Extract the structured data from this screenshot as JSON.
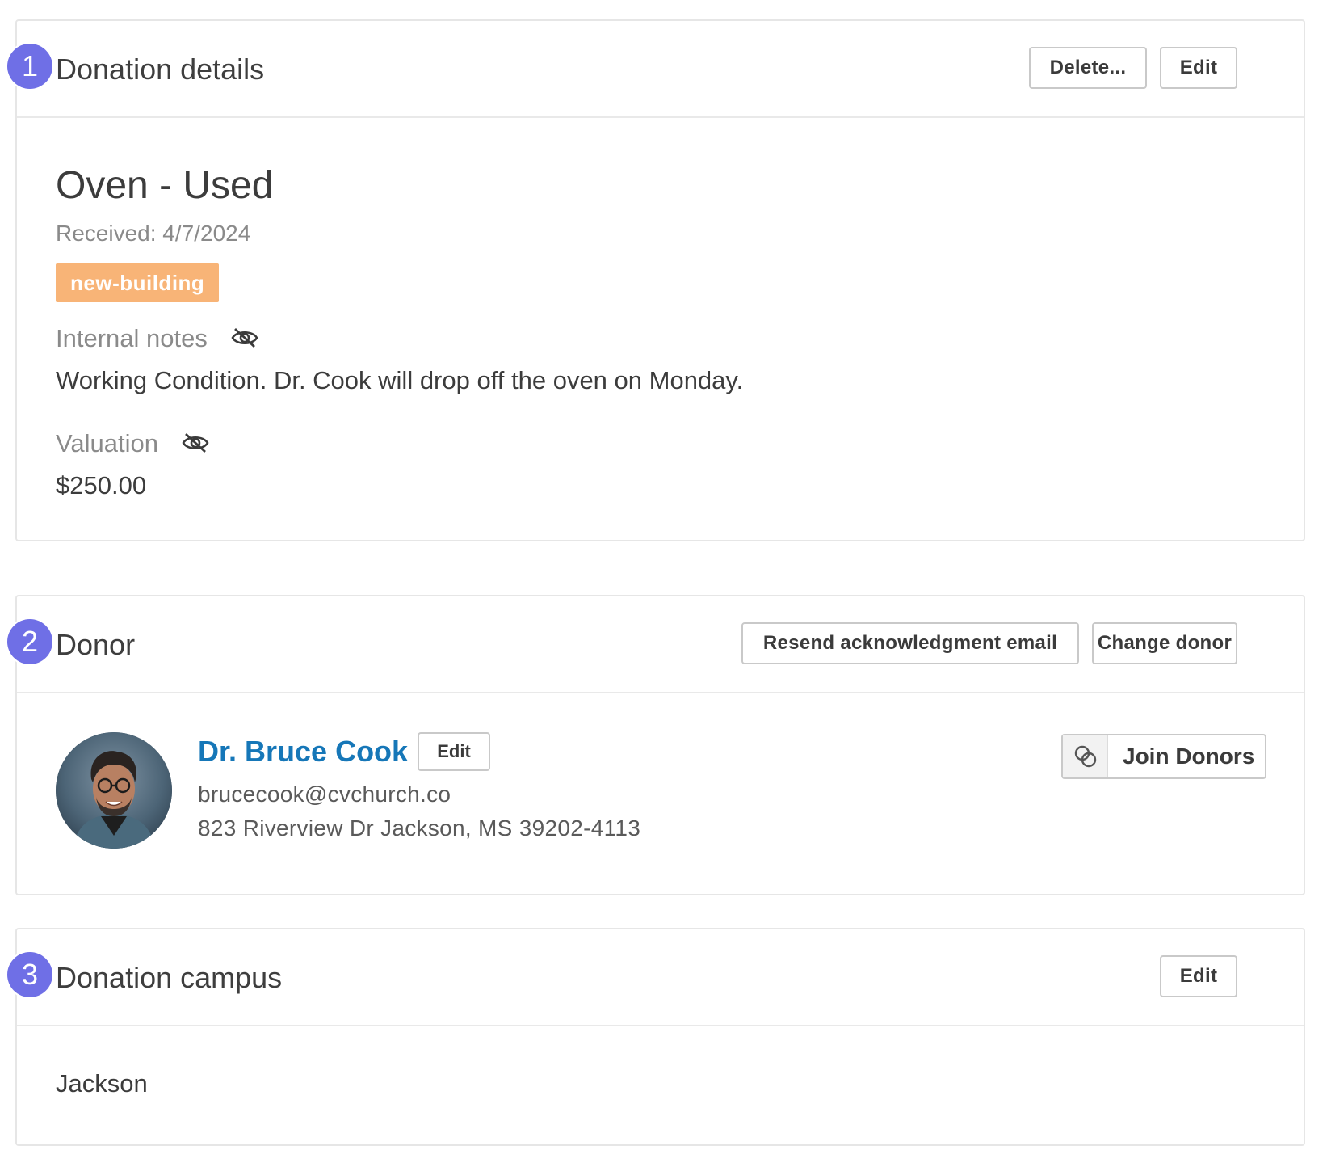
{
  "donation_details": {
    "step": "1",
    "title": "Donation details",
    "delete_label": "Delete...",
    "edit_label": "Edit",
    "item_title": "Oven - Used",
    "received": "Received: 4/7/2024",
    "tag": "new-building",
    "internal_notes_label": "Internal notes",
    "internal_notes_value": "Working Condition. Dr. Cook will drop off the oven on Monday.",
    "valuation_label": "Valuation",
    "valuation_value": "$250.00",
    "private_icon": "eye-slash-icon"
  },
  "donor": {
    "step": "2",
    "title": "Donor",
    "resend_label": "Resend acknowledgment email",
    "change_label": "Change donor",
    "name": "Dr. Bruce Cook",
    "edit_label": "Edit",
    "email": "brucecook@cvchurch.co",
    "address": "823 Riverview Dr Jackson, MS 39202-4113",
    "join_label": "Join Donors",
    "join_icon": "link-rings-icon"
  },
  "campus": {
    "step": "3",
    "title": "Donation campus",
    "edit_label": "Edit",
    "value": "Jackson"
  },
  "colors": {
    "accent_badge": "#6f6fe6",
    "tag_bg": "#f8b477",
    "donor_link": "#1677b8"
  }
}
